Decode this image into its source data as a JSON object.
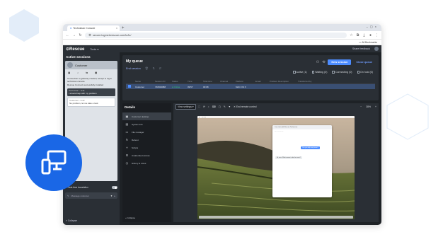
{
  "browser": {
    "tab_title": "Technician Console",
    "url": "secure.logmeinrescue.com/tc/tc/",
    "bookmarks_label": "All Bookmarks"
  },
  "app": {
    "logo": "Rescue",
    "menu_tools": "Tools",
    "share_feedback": "Share feedback"
  },
  "left_panel": {
    "title": "Active sessions",
    "customer_name": "Customer",
    "messages": [
      "Connection to gateway created, accept to log in technician console",
      "Rescue Connect successfully installed"
    ],
    "bubble_technician_meta": "Technician - 9:41",
    "bubble_technician_text": "I should help with my problem",
    "bubble_customer_meta": "Customer - 9:42",
    "bubble_customer_text": "No problem, let me take a look",
    "translate_label": "Real-time translation",
    "input_placeholder": "Message customer",
    "collapse_label": "Collapse"
  },
  "queue": {
    "title": "My queue",
    "end_session": "End session",
    "new_session": "New session",
    "close_queue": "Close queue",
    "filters": [
      "Active (1)",
      "Waiting (0)",
      "Connecting (0)",
      "On hold (0)"
    ],
    "columns": [
      "",
      "Name",
      "Session ID",
      "Status",
      "Time",
      "Total time",
      "Channel",
      "Platform",
      "Email",
      "Problem Description",
      "Transferred by"
    ],
    "rows": [
      [
        "",
        "Customer",
        "748323088",
        "● Online",
        "09:57",
        "00:08",
        "",
        "MAC OS X",
        "",
        "",
        ""
      ]
    ]
  },
  "details": {
    "title": "Details",
    "items": [
      "Customer desktop",
      "System info",
      "File manager",
      "Reboot",
      "Scripts",
      "Unattended access",
      "History & notes"
    ],
    "collapse_label": "Collapse"
  },
  "viewer": {
    "view_settings": "View settings",
    "end_remote_control": "End remote control",
    "zoom": "38%",
    "remote_window_title": "Live chat with Rescue Technician",
    "remote_bubble": "Can you help me please?",
    "remote_reply": "Hi, sure. What seems to be the issue?"
  },
  "colors": {
    "accent": "#4c8cff",
    "badge": "#1a67e6",
    "app_bg": "#1e2226",
    "panel_bg": "#2a2f35",
    "online": "#36c77a"
  }
}
